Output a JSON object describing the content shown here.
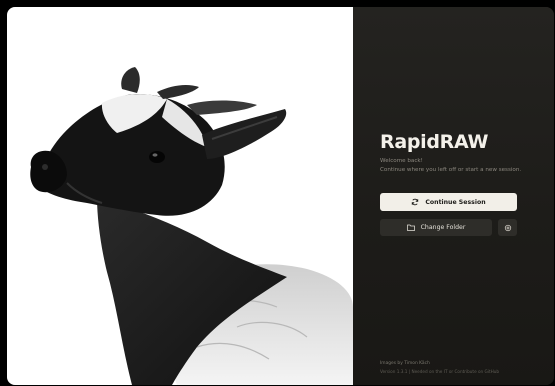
{
  "app": {
    "title": "RapidRAW",
    "welcome": "Welcome back!",
    "subtitle": "Continue where you left off or start a new session."
  },
  "actions": {
    "continue_label": "Continue Session",
    "change_folder_label": "Change Folder"
  },
  "icons": {
    "continue": "refresh-icon",
    "change_folder": "folder-icon",
    "settings": "gear-icon"
  },
  "footer": {
    "credit": "Images by Timon Käch",
    "version": "Version 1.3.1  |  Needed on the IT or Contribute on GitHub"
  },
  "colors": {
    "panel_bg": "#1d1c19",
    "primary_button": "#f2efe8",
    "secondary_button": "#2e2d29",
    "photo_bg": "#ffffff"
  }
}
